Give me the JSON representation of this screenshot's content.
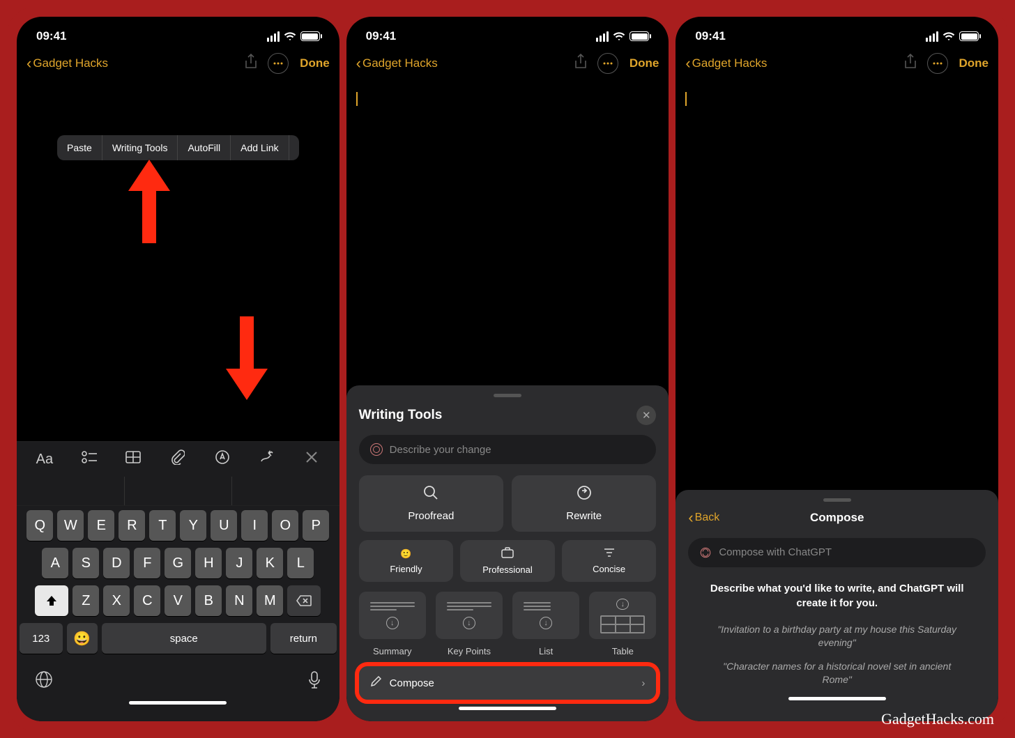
{
  "watermark": "GadgetHacks.com",
  "status": {
    "time": "09:41"
  },
  "nav": {
    "back_label": "Gadget Hacks",
    "done_label": "Done"
  },
  "context_menu": {
    "items": [
      "Paste",
      "Writing Tools",
      "AutoFill",
      "Add Link"
    ]
  },
  "kb_toolbar": {
    "aa": "Aa"
  },
  "keyboard": {
    "row1": [
      "Q",
      "W",
      "E",
      "R",
      "T",
      "Y",
      "U",
      "I",
      "O",
      "P"
    ],
    "row2": [
      "A",
      "S",
      "D",
      "F",
      "G",
      "H",
      "J",
      "K",
      "L"
    ],
    "row3": [
      "Z",
      "X",
      "C",
      "V",
      "B",
      "N",
      "M"
    ],
    "num": "123",
    "space": "space",
    "ret": "return"
  },
  "writing_tools": {
    "title": "Writing Tools",
    "placeholder": "Describe your change",
    "proofread": "Proofread",
    "rewrite": "Rewrite",
    "friendly": "Friendly",
    "professional": "Professional",
    "concise": "Concise",
    "summary": "Summary",
    "keypoints": "Key Points",
    "list": "List",
    "table": "Table",
    "compose": "Compose"
  },
  "compose": {
    "back": "Back",
    "title": "Compose",
    "placeholder": "Compose with ChatGPT",
    "instruction": "Describe what you'd like to write, and ChatGPT will create it for you.",
    "example1": "\"Invitation to a birthday party at my house this Saturday evening\"",
    "example2": "\"Character names for a historical novel set in ancient Rome\""
  }
}
